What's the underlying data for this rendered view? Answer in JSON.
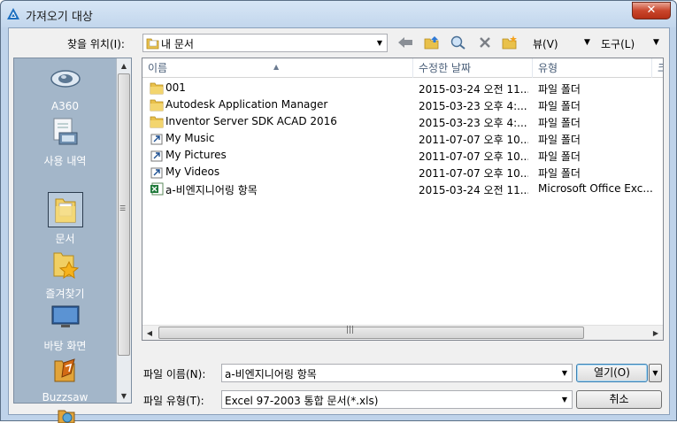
{
  "window": {
    "title": "가져오기 대상",
    "close_glyph": "✕"
  },
  "toolbar": {
    "look_in_label": "찾을 위치(I):",
    "look_in_value": "내 문서",
    "views_label": "뷰(V)",
    "tools_label": "도구(L)"
  },
  "places": [
    {
      "label": "A360",
      "icon": "a360-cloud-icon"
    },
    {
      "label": "사용 내역",
      "icon": "history-icon"
    },
    {
      "label": "문서",
      "icon": "documents-folder-icon",
      "selected": true
    },
    {
      "label": "즐겨찾기",
      "icon": "favorites-star-folder-icon"
    },
    {
      "label": "바탕 화면",
      "icon": "desktop-icon"
    },
    {
      "label": "Buzzsaw",
      "icon": "buzzsaw-icon"
    }
  ],
  "columns": {
    "name": "이름",
    "date": "수정한 날짜",
    "type": "유형",
    "extra": "크"
  },
  "files": [
    {
      "name": "001",
      "date": "2015-03-24 오전 11...",
      "type": "파일 폴더",
      "icon": "folder-icon"
    },
    {
      "name": "Autodesk Application Manager",
      "date": "2015-03-23 오후 4:...",
      "type": "파일 폴더",
      "icon": "folder-icon"
    },
    {
      "name": "Inventor Server SDK ACAD 2016",
      "date": "2015-03-23 오후 4:...",
      "type": "파일 폴더",
      "icon": "folder-icon"
    },
    {
      "name": "My Music",
      "date": "2011-07-07 오후 10...",
      "type": "파일 폴더",
      "icon": "shortcut-icon"
    },
    {
      "name": "My Pictures",
      "date": "2011-07-07 오후 10...",
      "type": "파일 폴더",
      "icon": "shortcut-icon"
    },
    {
      "name": "My Videos",
      "date": "2011-07-07 오후 10...",
      "type": "파일 폴더",
      "icon": "shortcut-icon"
    },
    {
      "name": "a-비엔지니어링 항목",
      "date": "2015-03-24 오전 11...",
      "type": "Microsoft Office Exc...",
      "icon": "excel-file-icon"
    }
  ],
  "bottom": {
    "filename_label": "파일 이름(N):",
    "filename_value": "a-비엔지니어링 항목",
    "filetype_label": "파일 유형(T):",
    "filetype_value": "Excel 97-2003 통합 문서(*.xls)",
    "open_label": "열기(O)",
    "cancel_label": "취소"
  }
}
